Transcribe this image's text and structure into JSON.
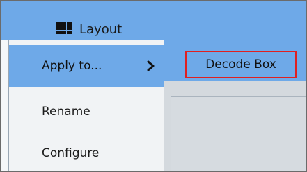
{
  "header": {
    "layout_label": "Layout",
    "layout_icon": "layout-grid-icon",
    "accent_color": "#6ea9e8"
  },
  "context_menu": {
    "items": [
      {
        "label": "Apply to...",
        "has_submenu": true,
        "submenu_icon": "chevron-right-icon",
        "active": true
      },
      {
        "label": "Rename"
      },
      {
        "label": "Configure"
      }
    ]
  },
  "submenu": {
    "items": [
      {
        "label": "Decode Box",
        "highlight_color": "#e02020"
      }
    ]
  }
}
